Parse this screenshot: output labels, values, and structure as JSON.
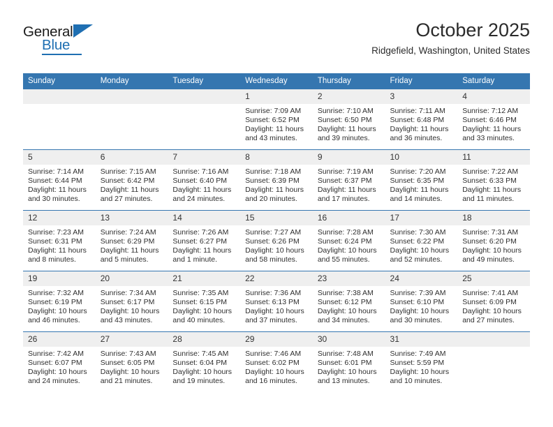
{
  "brand": {
    "name_top": "General",
    "name_bottom": "Blue",
    "accent_color": "#1f6fb2"
  },
  "header": {
    "title": "October 2025",
    "subtitle": "Ridgefield, Washington, United States"
  },
  "theme": {
    "header_blue": "#3576b0",
    "daynum_band": "#efefef",
    "text": "#2f2f2f"
  },
  "calendar": {
    "weekday_headers": [
      "Sunday",
      "Monday",
      "Tuesday",
      "Wednesday",
      "Thursday",
      "Friday",
      "Saturday"
    ],
    "labels": {
      "sunrise": "Sunrise:",
      "sunset": "Sunset:",
      "daylight": "Daylight:"
    },
    "weeks": [
      [
        {
          "day": "",
          "sunrise": "",
          "sunset": "",
          "daylight_line1": "",
          "daylight_line2": ""
        },
        {
          "day": "",
          "sunrise": "",
          "sunset": "",
          "daylight_line1": "",
          "daylight_line2": ""
        },
        {
          "day": "",
          "sunrise": "",
          "sunset": "",
          "daylight_line1": "",
          "daylight_line2": ""
        },
        {
          "day": "1",
          "sunrise": "Sunrise: 7:09 AM",
          "sunset": "Sunset: 6:52 PM",
          "daylight_line1": "Daylight: 11 hours",
          "daylight_line2": "and 43 minutes."
        },
        {
          "day": "2",
          "sunrise": "Sunrise: 7:10 AM",
          "sunset": "Sunset: 6:50 PM",
          "daylight_line1": "Daylight: 11 hours",
          "daylight_line2": "and 39 minutes."
        },
        {
          "day": "3",
          "sunrise": "Sunrise: 7:11 AM",
          "sunset": "Sunset: 6:48 PM",
          "daylight_line1": "Daylight: 11 hours",
          "daylight_line2": "and 36 minutes."
        },
        {
          "day": "4",
          "sunrise": "Sunrise: 7:12 AM",
          "sunset": "Sunset: 6:46 PM",
          "daylight_line1": "Daylight: 11 hours",
          "daylight_line2": "and 33 minutes."
        }
      ],
      [
        {
          "day": "5",
          "sunrise": "Sunrise: 7:14 AM",
          "sunset": "Sunset: 6:44 PM",
          "daylight_line1": "Daylight: 11 hours",
          "daylight_line2": "and 30 minutes."
        },
        {
          "day": "6",
          "sunrise": "Sunrise: 7:15 AM",
          "sunset": "Sunset: 6:42 PM",
          "daylight_line1": "Daylight: 11 hours",
          "daylight_line2": "and 27 minutes."
        },
        {
          "day": "7",
          "sunrise": "Sunrise: 7:16 AM",
          "sunset": "Sunset: 6:40 PM",
          "daylight_line1": "Daylight: 11 hours",
          "daylight_line2": "and 24 minutes."
        },
        {
          "day": "8",
          "sunrise": "Sunrise: 7:18 AM",
          "sunset": "Sunset: 6:39 PM",
          "daylight_line1": "Daylight: 11 hours",
          "daylight_line2": "and 20 minutes."
        },
        {
          "day": "9",
          "sunrise": "Sunrise: 7:19 AM",
          "sunset": "Sunset: 6:37 PM",
          "daylight_line1": "Daylight: 11 hours",
          "daylight_line2": "and 17 minutes."
        },
        {
          "day": "10",
          "sunrise": "Sunrise: 7:20 AM",
          "sunset": "Sunset: 6:35 PM",
          "daylight_line1": "Daylight: 11 hours",
          "daylight_line2": "and 14 minutes."
        },
        {
          "day": "11",
          "sunrise": "Sunrise: 7:22 AM",
          "sunset": "Sunset: 6:33 PM",
          "daylight_line1": "Daylight: 11 hours",
          "daylight_line2": "and 11 minutes."
        }
      ],
      [
        {
          "day": "12",
          "sunrise": "Sunrise: 7:23 AM",
          "sunset": "Sunset: 6:31 PM",
          "daylight_line1": "Daylight: 11 hours",
          "daylight_line2": "and 8 minutes."
        },
        {
          "day": "13",
          "sunrise": "Sunrise: 7:24 AM",
          "sunset": "Sunset: 6:29 PM",
          "daylight_line1": "Daylight: 11 hours",
          "daylight_line2": "and 5 minutes."
        },
        {
          "day": "14",
          "sunrise": "Sunrise: 7:26 AM",
          "sunset": "Sunset: 6:27 PM",
          "daylight_line1": "Daylight: 11 hours",
          "daylight_line2": "and 1 minute."
        },
        {
          "day": "15",
          "sunrise": "Sunrise: 7:27 AM",
          "sunset": "Sunset: 6:26 PM",
          "daylight_line1": "Daylight: 10 hours",
          "daylight_line2": "and 58 minutes."
        },
        {
          "day": "16",
          "sunrise": "Sunrise: 7:28 AM",
          "sunset": "Sunset: 6:24 PM",
          "daylight_line1": "Daylight: 10 hours",
          "daylight_line2": "and 55 minutes."
        },
        {
          "day": "17",
          "sunrise": "Sunrise: 7:30 AM",
          "sunset": "Sunset: 6:22 PM",
          "daylight_line1": "Daylight: 10 hours",
          "daylight_line2": "and 52 minutes."
        },
        {
          "day": "18",
          "sunrise": "Sunrise: 7:31 AM",
          "sunset": "Sunset: 6:20 PM",
          "daylight_line1": "Daylight: 10 hours",
          "daylight_line2": "and 49 minutes."
        }
      ],
      [
        {
          "day": "19",
          "sunrise": "Sunrise: 7:32 AM",
          "sunset": "Sunset: 6:19 PM",
          "daylight_line1": "Daylight: 10 hours",
          "daylight_line2": "and 46 minutes."
        },
        {
          "day": "20",
          "sunrise": "Sunrise: 7:34 AM",
          "sunset": "Sunset: 6:17 PM",
          "daylight_line1": "Daylight: 10 hours",
          "daylight_line2": "and 43 minutes."
        },
        {
          "day": "21",
          "sunrise": "Sunrise: 7:35 AM",
          "sunset": "Sunset: 6:15 PM",
          "daylight_line1": "Daylight: 10 hours",
          "daylight_line2": "and 40 minutes."
        },
        {
          "day": "22",
          "sunrise": "Sunrise: 7:36 AM",
          "sunset": "Sunset: 6:13 PM",
          "daylight_line1": "Daylight: 10 hours",
          "daylight_line2": "and 37 minutes."
        },
        {
          "day": "23",
          "sunrise": "Sunrise: 7:38 AM",
          "sunset": "Sunset: 6:12 PM",
          "daylight_line1": "Daylight: 10 hours",
          "daylight_line2": "and 34 minutes."
        },
        {
          "day": "24",
          "sunrise": "Sunrise: 7:39 AM",
          "sunset": "Sunset: 6:10 PM",
          "daylight_line1": "Daylight: 10 hours",
          "daylight_line2": "and 30 minutes."
        },
        {
          "day": "25",
          "sunrise": "Sunrise: 7:41 AM",
          "sunset": "Sunset: 6:09 PM",
          "daylight_line1": "Daylight: 10 hours",
          "daylight_line2": "and 27 minutes."
        }
      ],
      [
        {
          "day": "26",
          "sunrise": "Sunrise: 7:42 AM",
          "sunset": "Sunset: 6:07 PM",
          "daylight_line1": "Daylight: 10 hours",
          "daylight_line2": "and 24 minutes."
        },
        {
          "day": "27",
          "sunrise": "Sunrise: 7:43 AM",
          "sunset": "Sunset: 6:05 PM",
          "daylight_line1": "Daylight: 10 hours",
          "daylight_line2": "and 21 minutes."
        },
        {
          "day": "28",
          "sunrise": "Sunrise: 7:45 AM",
          "sunset": "Sunset: 6:04 PM",
          "daylight_line1": "Daylight: 10 hours",
          "daylight_line2": "and 19 minutes."
        },
        {
          "day": "29",
          "sunrise": "Sunrise: 7:46 AM",
          "sunset": "Sunset: 6:02 PM",
          "daylight_line1": "Daylight: 10 hours",
          "daylight_line2": "and 16 minutes."
        },
        {
          "day": "30",
          "sunrise": "Sunrise: 7:48 AM",
          "sunset": "Sunset: 6:01 PM",
          "daylight_line1": "Daylight: 10 hours",
          "daylight_line2": "and 13 minutes."
        },
        {
          "day": "31",
          "sunrise": "Sunrise: 7:49 AM",
          "sunset": "Sunset: 5:59 PM",
          "daylight_line1": "Daylight: 10 hours",
          "daylight_line2": "and 10 minutes."
        },
        {
          "day": "",
          "sunrise": "",
          "sunset": "",
          "daylight_line1": "",
          "daylight_line2": ""
        }
      ]
    ]
  }
}
